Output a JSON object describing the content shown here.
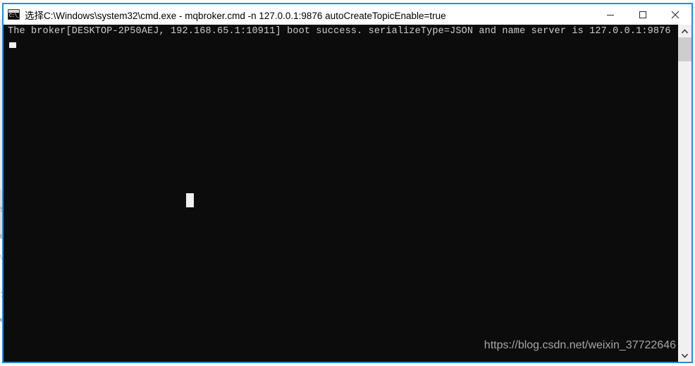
{
  "window": {
    "icon_name": "cmd-exe-icon",
    "icon_glyph": "C:\\_",
    "title": "选择C:\\Windows\\system32\\cmd.exe - mqbroker.cmd    -n 127.0.0.1:9876 autoCreateTopicEnable=true",
    "controls": {
      "minimize_label": "Minimize",
      "maximize_label": "Maximize",
      "close_label": "Close"
    },
    "border_color": "#1e8fe0",
    "titlebar_bg": "#ffffff",
    "console_bg": "#0c0c0c",
    "console_fg": "#cccccc"
  },
  "console": {
    "lines": [
      "The broker[DESKTOP-2P50AEJ, 192.168.65.1:10911] boot success. serializeType=JSON and name server is 127.0.0.1:9876"
    ],
    "caret_name": "cursor-block",
    "selection_name": "selection-block",
    "watermark": "https://blog.csdn.net/weixin_37722646"
  },
  "scrollbar": {
    "up_arrow_label": "Scroll up",
    "down_arrow_label": "Scroll down",
    "thumb_label": "Scrollbar thumb",
    "track_color": "#f0f0f0",
    "thumb_color": "#cdcdcd"
  },
  "backdrop": {
    "left_fragments": [
      "S",
      "t",
      "\\",
      "ジ",
      "e"
    ],
    "right_fragments": [
      "▮",
      "◦",
      "▫"
    ]
  }
}
